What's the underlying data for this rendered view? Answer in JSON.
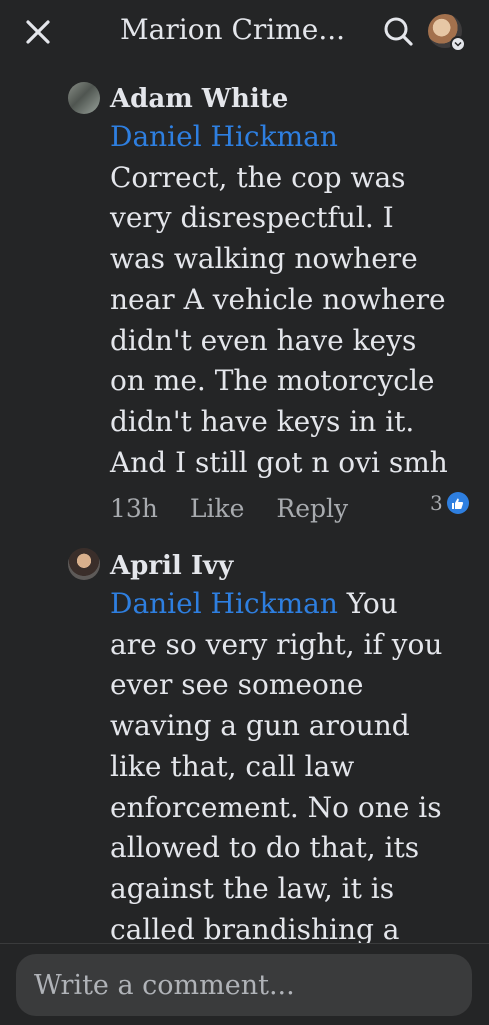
{
  "header": {
    "title": "Marion Crime...",
    "close_icon": "close-icon",
    "search_icon": "search-icon"
  },
  "comments": [
    {
      "author": "Adam White",
      "mention": "Daniel Hickman",
      "lines": [
        "Correct, the cop was",
        "very disrespectful. I",
        "was walking nowhere",
        "near A vehicle nowhere",
        "didn't even have keys",
        "on me. The motorcycle",
        "didn't have keys in it.",
        "And I still got n ovi smh"
      ],
      "time": "13h",
      "like_label": "Like",
      "reply_label": "Reply",
      "reaction_count": "3"
    },
    {
      "author": "April Ivy",
      "mention": "Daniel Hickman",
      "first_line_rest": "You",
      "lines": [
        "are so very right, if you",
        "ever see someone",
        "waving a gun around",
        "like that, call law",
        "enforcement. No one is",
        "allowed to do that, its",
        "against the law, it is",
        "called brandishing a"
      ]
    }
  ],
  "composer": {
    "placeholder": "Write a comment..."
  },
  "colors": {
    "background": "#242526",
    "mention": "#2e7fe0",
    "text": "#e4e6eb",
    "muted": "#a8abaf"
  }
}
